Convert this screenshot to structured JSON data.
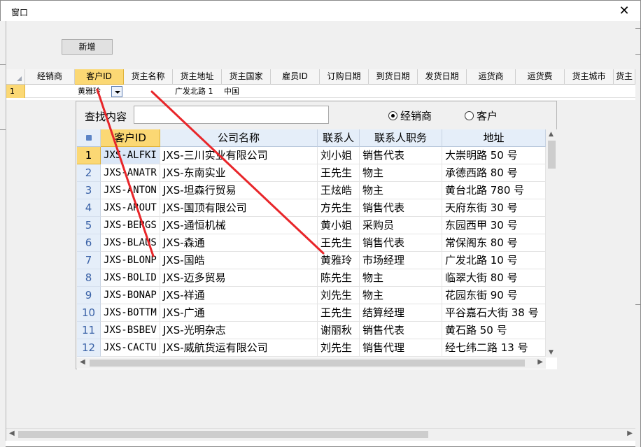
{
  "window": {
    "title": "窗口",
    "close_symbol": "✕"
  },
  "toolbar": {
    "add_label": "新增"
  },
  "main_grid": {
    "columns": [
      "经销商",
      "客户ID",
      "货主名称",
      "货主地址",
      "货主国家",
      "雇员ID",
      "订购日期",
      "到货日期",
      "发货日期",
      "运货商",
      "运货费",
      "货主城市",
      "货主"
    ],
    "selected_column": "客户ID",
    "rows": [
      {
        "num": "1",
        "dealer": "",
        "customer_id": "黄雅玲",
        "owner_name": "",
        "owner_address": "广发北路 1",
        "owner_country": "中国"
      }
    ]
  },
  "popup": {
    "search_label": "查找内容",
    "search_value": "",
    "radio_dealer": "经销商",
    "radio_customer": "客户",
    "selected_radio": "经销商",
    "columns": [
      "客户ID",
      "公司名称",
      "联系人",
      "联系人职务",
      "地址"
    ],
    "rows": [
      [
        "1",
        "JXS-ALFKI",
        "JXS-三川实业有限公司",
        "刘小姐",
        "销售代表",
        "大崇明路 50 号"
      ],
      [
        "2",
        "JXS-ANATR",
        "JXS-东南实业",
        "王先生",
        "物主",
        "承德西路 80 号"
      ],
      [
        "3",
        "JXS-ANTON",
        "JXS-坦森行贸易",
        "王炫皓",
        "物主",
        "黄台北路 780 号"
      ],
      [
        "4",
        "JXS-AROUT",
        "JXS-国顶有限公司",
        "方先生",
        "销售代表",
        "天府东街 30 号"
      ],
      [
        "5",
        "JXS-BERGS",
        "JXS-通恒机械",
        "黄小姐",
        "采购员",
        "东园西甲 30 号"
      ],
      [
        "6",
        "JXS-BLAUS",
        "JXS-森通",
        "王先生",
        "销售代表",
        "常保阁东 80 号"
      ],
      [
        "7",
        "JXS-BLONP",
        "JXS-国皓",
        "黄雅玲",
        "市场经理",
        "广发北路 10 号"
      ],
      [
        "8",
        "JXS-BOLID",
        "JXS-迈多贸易",
        "陈先生",
        "物主",
        "临翠大街 80 号"
      ],
      [
        "9",
        "JXS-BONAP",
        "JXS-祥通",
        "刘先生",
        "物主",
        "花园东街 90 号"
      ],
      [
        "10",
        "JXS-BOTTM",
        "JXS-广通",
        "王先生",
        "结算经理",
        "平谷嘉石大街 38 号"
      ],
      [
        "11",
        "JXS-BSBEV",
        "JXS-光明杂志",
        "谢丽秋",
        "销售代表",
        "黄石路 50 号"
      ],
      [
        "12",
        "JXS-CACTU",
        "JXS-威航货运有限公司",
        "刘先生",
        "销售代理",
        "经七纬二路 13 号"
      ]
    ]
  },
  "icons": {
    "sort_corner": "triangle-icon",
    "lock": "lock-icon",
    "dropdown": "chevron-down-icon"
  },
  "colors": {
    "selected": "#fbd874",
    "header": "#e5eef9",
    "annotation": "#e8262a"
  }
}
